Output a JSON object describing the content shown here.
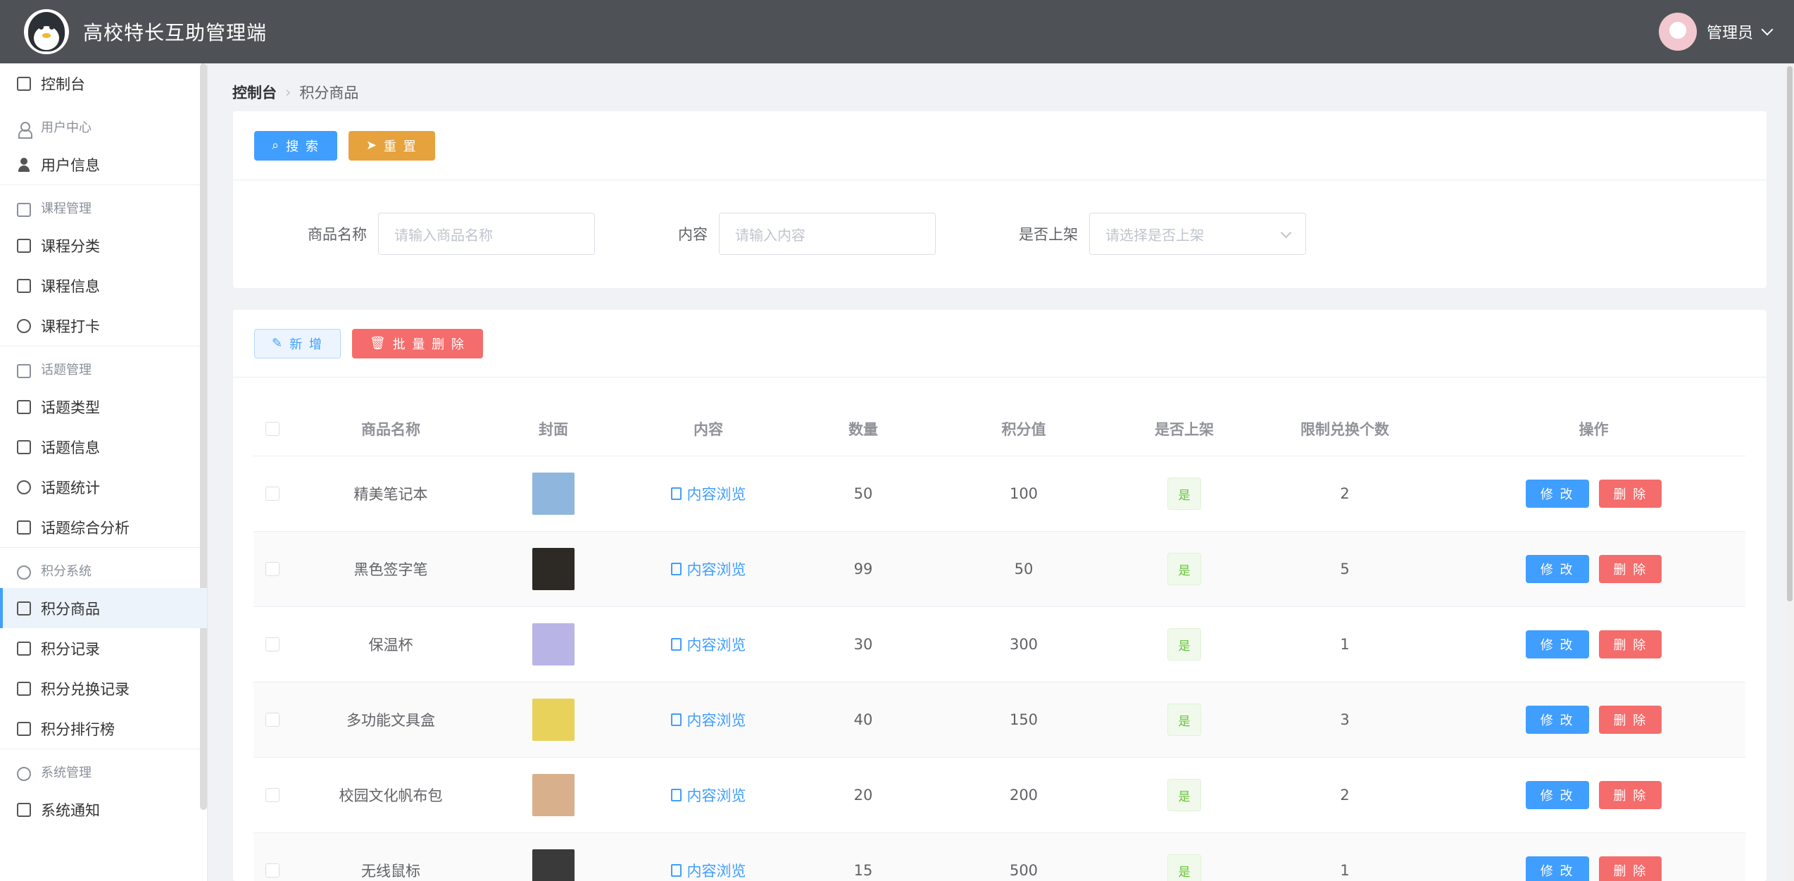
{
  "app": {
    "title": "高校特长互助管理端",
    "user": "管理员"
  },
  "sidebar": {
    "items": [
      {
        "type": "item",
        "label": "控制台",
        "icon": "dashboard-icon"
      },
      {
        "type": "group",
        "label": "用户中心",
        "icon": "user-icon"
      },
      {
        "type": "item",
        "label": "用户信息",
        "icon": "user-icon"
      },
      {
        "type": "group",
        "label": "课程管理",
        "icon": "book-icon"
      },
      {
        "type": "item",
        "label": "课程分类",
        "icon": "bookmark-icon"
      },
      {
        "type": "item",
        "label": "课程信息",
        "icon": "notebook-icon"
      },
      {
        "type": "item",
        "label": "课程打卡",
        "icon": "stopwatch-icon"
      },
      {
        "type": "group",
        "label": "话题管理",
        "icon": "chat-icon"
      },
      {
        "type": "item",
        "label": "话题类型",
        "icon": "notebook-icon"
      },
      {
        "type": "item",
        "label": "话题信息",
        "icon": "comment-icon"
      },
      {
        "type": "item",
        "label": "话题统计",
        "icon": "pie-chart-icon"
      },
      {
        "type": "item",
        "label": "话题综合分析",
        "icon": "dashboard-icon"
      },
      {
        "type": "group",
        "label": "积分系统",
        "icon": "medal-icon"
      },
      {
        "type": "item",
        "label": "积分商品",
        "icon": "shopping-bag-icon",
        "active": true
      },
      {
        "type": "item",
        "label": "积分记录",
        "icon": "notebook-icon"
      },
      {
        "type": "item",
        "label": "积分兑换记录",
        "icon": "cart-icon"
      },
      {
        "type": "item",
        "label": "积分排行榜",
        "icon": "trophy-icon"
      },
      {
        "type": "group",
        "label": "系统管理",
        "icon": "gear-icon"
      },
      {
        "type": "item",
        "label": "系统通知",
        "icon": "bell-icon"
      }
    ]
  },
  "breadcrumb": {
    "home": "控制台",
    "current": "积分商品"
  },
  "search": {
    "search_label": "搜 索",
    "reset_label": "重 置",
    "name_label": "商品名称",
    "name_placeholder": "请输入商品名称",
    "content_label": "内容",
    "content_placeholder": "请输入内容",
    "shelf_label": "是否上架",
    "shelf_placeholder": "请选择是否上架"
  },
  "toolbar": {
    "add_label": "新 增",
    "batch_delete_label": "批 量 删 除"
  },
  "table": {
    "headers": [
      "商品名称",
      "封面",
      "内容",
      "数量",
      "积分值",
      "是否上架",
      "限制兑换个数",
      "操作"
    ],
    "edit_label": "修 改",
    "delete_label": "删 除",
    "rows": [
      {
        "name": "精美笔记本",
        "content": "内容浏览",
        "qty": "50",
        "points": "100",
        "shelf": "是",
        "limit": "2",
        "cover_color": "#8fb6dc"
      },
      {
        "name": "黑色签字笔",
        "content": "内容浏览",
        "qty": "99",
        "points": "50",
        "shelf": "是",
        "limit": "5",
        "cover_color": "#2d2a25"
      },
      {
        "name": "保温杯",
        "content": "内容浏览",
        "qty": "30",
        "points": "300",
        "shelf": "是",
        "limit": "1",
        "cover_color": "#b9b4e6"
      },
      {
        "name": "多功能文具盒",
        "content": "内容浏览",
        "qty": "40",
        "points": "150",
        "shelf": "是",
        "limit": "3",
        "cover_color": "#e8d25b"
      },
      {
        "name": "校园文化帆布包",
        "content": "内容浏览",
        "qty": "20",
        "points": "200",
        "shelf": "是",
        "limit": "2",
        "cover_color": "#d9b08c"
      },
      {
        "name": "无线鼠标",
        "content": "内容浏览",
        "qty": "15",
        "points": "500",
        "shelf": "是",
        "limit": "1",
        "cover_color": "#3a3a3a"
      }
    ]
  },
  "colors": {
    "header": "#4e5257",
    "primary": "#409eff",
    "warning": "#e6a23c",
    "danger": "#f56c6c",
    "success": "#67c23a"
  }
}
